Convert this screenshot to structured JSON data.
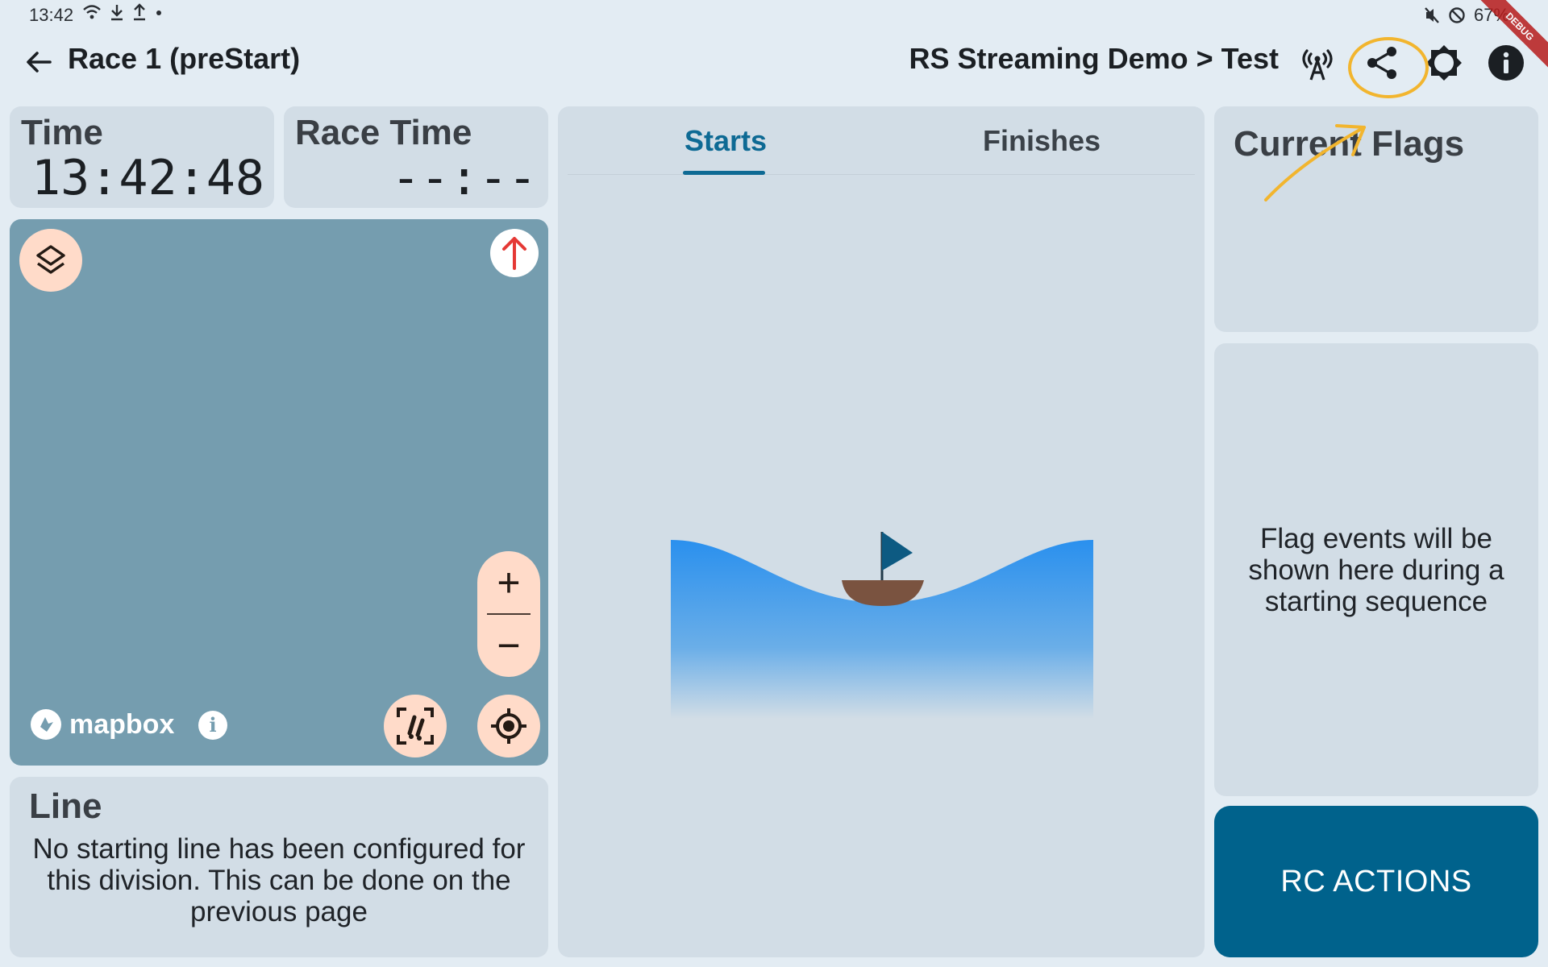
{
  "status_bar": {
    "time": "13:42",
    "battery": "67%"
  },
  "debug_banner": "DEBUG",
  "app_bar": {
    "title": "Race 1 (preStart)",
    "breadcrumb": "RS Streaming Demo > Test"
  },
  "time_card": {
    "label": "Time",
    "value": "13:42:48"
  },
  "race_time_card": {
    "label": "Race Time",
    "value": "--:--"
  },
  "map": {
    "attribution": "mapbox",
    "info_glyph": "i",
    "zoom_in_glyph": "+",
    "zoom_out_glyph": "−"
  },
  "line_card": {
    "title": "Line",
    "message": "No starting line has been configured for this division. This can be done on the previous page"
  },
  "tabs": [
    {
      "label": "Starts",
      "active": true
    },
    {
      "label": "Finishes",
      "active": false
    }
  ],
  "flags": {
    "title": "Current Flags",
    "empty_message": "Flag events will be shown here during a starting sequence"
  },
  "rc_actions_label": "RC ACTIONS",
  "colors": {
    "primary": "#00628c",
    "tab_active": "#0e6a94",
    "fab_bg": "#ffdbc9",
    "map_bg": "#759daf",
    "card_bg": "#d2dde6",
    "page_bg": "#e3ecf3",
    "annotation": "#f2b52e"
  }
}
